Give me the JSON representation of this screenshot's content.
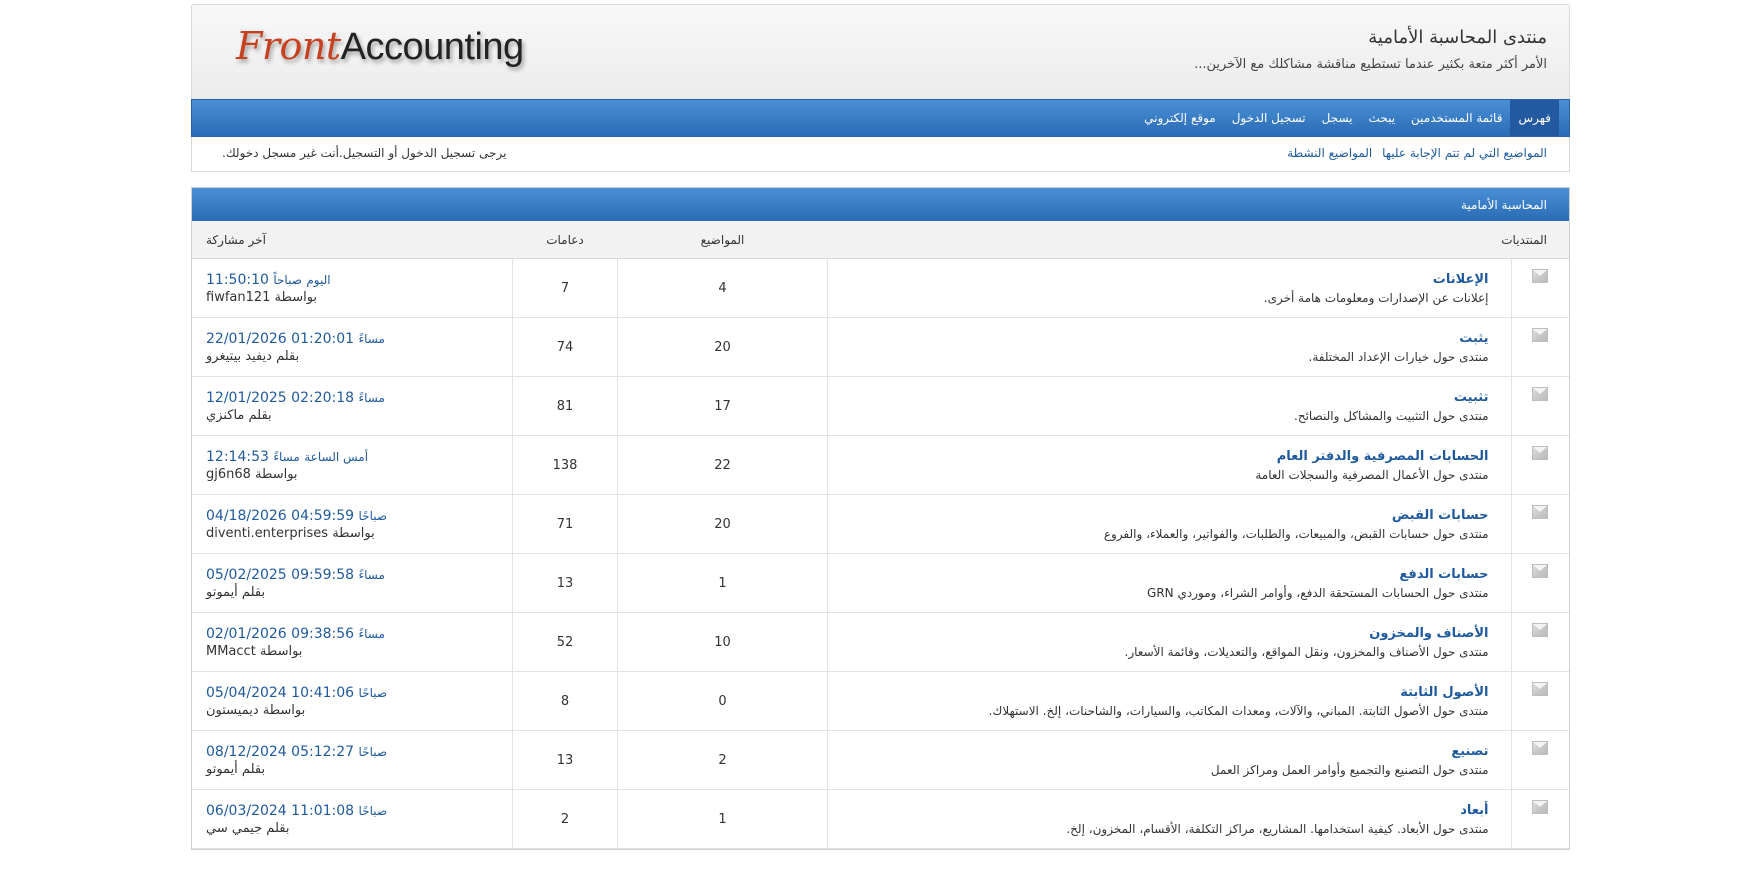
{
  "header": {
    "logo_front": "Front",
    "logo_accounting": "Accounting",
    "board_title": "منتدى المحاسبة الأمامية",
    "board_description": "الأمر أكثر متعة بكثير عندما تستطيع مناقشة مشاكلك مع الآخرين..."
  },
  "nav": {
    "items": [
      "فهرس",
      "قائمة المستخدمين",
      "يبحث",
      "يسجل",
      "تسجيل الدخول",
      "موقع إلكتروني"
    ],
    "active": "فهرس"
  },
  "status": {
    "link_unanswered": "المواضيع التي لم تتم الإجابة عليها",
    "link_active": "المواضيع النشطة",
    "message": "يرجى تسجيل الدخول أو التسجيل.أنت غير مسجل دخولك."
  },
  "category": {
    "name": "المحاسبة الأمامية",
    "columns": {
      "forums": "المنتديات",
      "topics": "المواضيع",
      "posts": "دعامات",
      "last_post": "آخر مشاركة"
    },
    "forums": [
      {
        "name": "الإعلانات",
        "desc": "إعلانات عن الإصدارات ومعلومات هامة أخرى.",
        "topics": "4",
        "posts": "7",
        "last_pre": "اليوم",
        "last_time": "11:50:10",
        "last_suffix": "صباحاً",
        "last_by": "بواسطة fiwfan121"
      },
      {
        "name": "يثبت",
        "desc": "منتدى حول خيارات الإعداد المختلفة.",
        "topics": "20",
        "posts": "74",
        "last_pre": "",
        "last_time": "01:20:01 22/01/2026",
        "last_suffix": "مساءً",
        "last_by": "بقلم ديفيد بيتيغرو"
      },
      {
        "name": "تثبيت",
        "desc": "منتدى حول التثبيت والمشاكل والنصائح.",
        "topics": "17",
        "posts": "81",
        "last_pre": "",
        "last_time": "02:20:18 12/01/2025",
        "last_suffix": "مساءً",
        "last_by": "بقلم ماكنزي"
      },
      {
        "name": "الحسابات المصرفية والدفتر العام",
        "desc": "منتدى حول الأعمال المصرفية والسجلات العامة",
        "topics": "22",
        "posts": "138",
        "last_pre": "أمس الساعة",
        "last_time": "12:14:53",
        "last_suffix": "مساءً",
        "last_by": "بواسطة gj6n68"
      },
      {
        "name": "حسابات القبض",
        "desc": "منتدى حول حسابات القبض، والمبيعات، والطلبات، والفواتير، والعملاء، والفروع",
        "topics": "20",
        "posts": "71",
        "last_pre": "",
        "last_time": "04:59:59 04/18/2026",
        "last_suffix": "صباحًا",
        "last_by": "بواسطة diventi.enterprises"
      },
      {
        "name": "حسابات الدفع",
        "desc": "منتدى حول الحسابات المستحقة الدفع، وأوامر الشراء، وموردي GRN",
        "topics": "1",
        "posts": "13",
        "last_pre": "",
        "last_time": "09:59:58 05/02/2025",
        "last_suffix": "مساءً",
        "last_by": "بقلم أيموتو"
      },
      {
        "name": "الأصناف والمخزون",
        "desc": "منتدى حول الأصناف والمخزون، ونقل المواقع، والتعديلات، وقائمة الأسعار.",
        "topics": "10",
        "posts": "52",
        "last_pre": "",
        "last_time": "09:38:56 02/01/2026",
        "last_suffix": "مساءً",
        "last_by": "بواسطة MMacct"
      },
      {
        "name": "الأصول الثابتة",
        "desc": "منتدى حول الأصول الثابتة. المباني، والآلات، ومعدات المكاتب، والسيارات، والشاحنات، إلخ. الاستهلاك.",
        "topics": "0",
        "posts": "8",
        "last_pre": "",
        "last_time": "10:41:06 05/04/2024",
        "last_suffix": "صباحًا",
        "last_by": "بواسطة ديميستون"
      },
      {
        "name": "تصنيع",
        "desc": "منتدى حول التصنيع والتجميع وأوامر العمل ومراكز العمل",
        "topics": "2",
        "posts": "13",
        "last_pre": "",
        "last_time": "05:12:27 08/12/2024",
        "last_suffix": "صباحًا",
        "last_by": "بقلم أيموتو"
      },
      {
        "name": "أبعاد",
        "desc": "منتدى حول الأبعاد. كيفية استخدامها. المشاريع، مراكز التكلفة، الأقسام، المخزون، إلخ.",
        "topics": "1",
        "posts": "2",
        "last_pre": "",
        "last_time": "11:01:08 06/03/2024",
        "last_suffix": "صباحًا",
        "last_by": "بقلم جيمي سي"
      }
    ]
  }
}
